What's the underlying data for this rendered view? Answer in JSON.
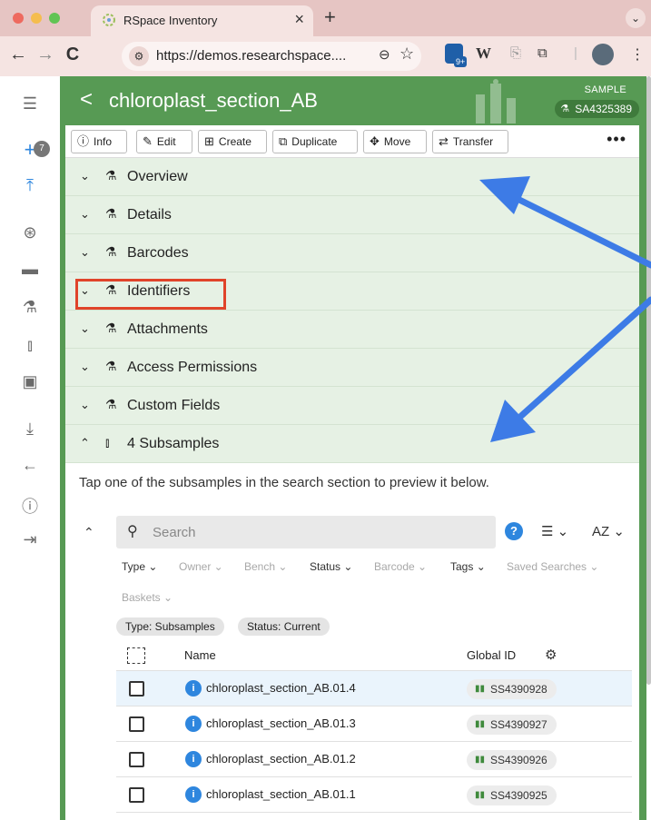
{
  "browser": {
    "tab_title": "RSpace Inventory",
    "tab_close": "×",
    "new_tab": "+",
    "tab_menu": "⌄",
    "url": "https://demos.researchspace....",
    "ext_badge": "9+",
    "ext_w": "W"
  },
  "rail": {
    "badge_count": "7"
  },
  "header": {
    "back": "<",
    "title": "chloroplast_section_AB",
    "record_type": "SAMPLE",
    "global_id": "SA4325389"
  },
  "actions": {
    "info": "Info",
    "edit": "Edit",
    "create": "Create",
    "duplicate": "Duplicate",
    "move": "Move",
    "transfer": "Transfer",
    "more": "•••"
  },
  "sections": [
    {
      "title": "Overview",
      "expanded": false
    },
    {
      "title": "Details",
      "expanded": false
    },
    {
      "title": "Barcodes",
      "expanded": false
    },
    {
      "title": "Identifiers",
      "expanded": false
    },
    {
      "title": "Attachments",
      "expanded": false
    },
    {
      "title": "Access Permissions",
      "expanded": false
    },
    {
      "title": "Custom Fields",
      "expanded": false
    },
    {
      "title": "4 Subsamples",
      "expanded": true
    }
  ],
  "subsamples": {
    "hint": "Tap one of the subsamples in the search section to preview it below.",
    "search_placeholder": "Search",
    "search_value": "",
    "sort_label": "AZ",
    "filters": [
      {
        "label": "Type",
        "active": true
      },
      {
        "label": "Owner",
        "active": false
      },
      {
        "label": "Bench",
        "active": false
      },
      {
        "label": "Status",
        "active": true
      },
      {
        "label": "Barcode",
        "active": false
      },
      {
        "label": "Tags",
        "active": true
      },
      {
        "label": "Saved Searches",
        "active": false
      },
      {
        "label": "Baskets",
        "active": false
      }
    ],
    "chips": [
      "Type: Subsamples",
      "Status: Current"
    ],
    "columns": {
      "name": "Name",
      "global_id": "Global ID"
    },
    "rows": [
      {
        "name": "chloroplast_section_AB.01.4",
        "global_id": "SS4390928"
      },
      {
        "name": "chloroplast_section_AB.01.3",
        "global_id": "SS4390927"
      },
      {
        "name": "chloroplast_section_AB.01.2",
        "global_id": "SS4390926"
      },
      {
        "name": "chloroplast_section_AB.01.1",
        "global_id": "SS4390925"
      }
    ]
  },
  "colors": {
    "brand_green": "#579a54",
    "section_bg": "#e6f1e4",
    "accent_blue": "#2e86de",
    "highlight_red": "#e0442a",
    "arrow_blue": "#3d7be6"
  }
}
